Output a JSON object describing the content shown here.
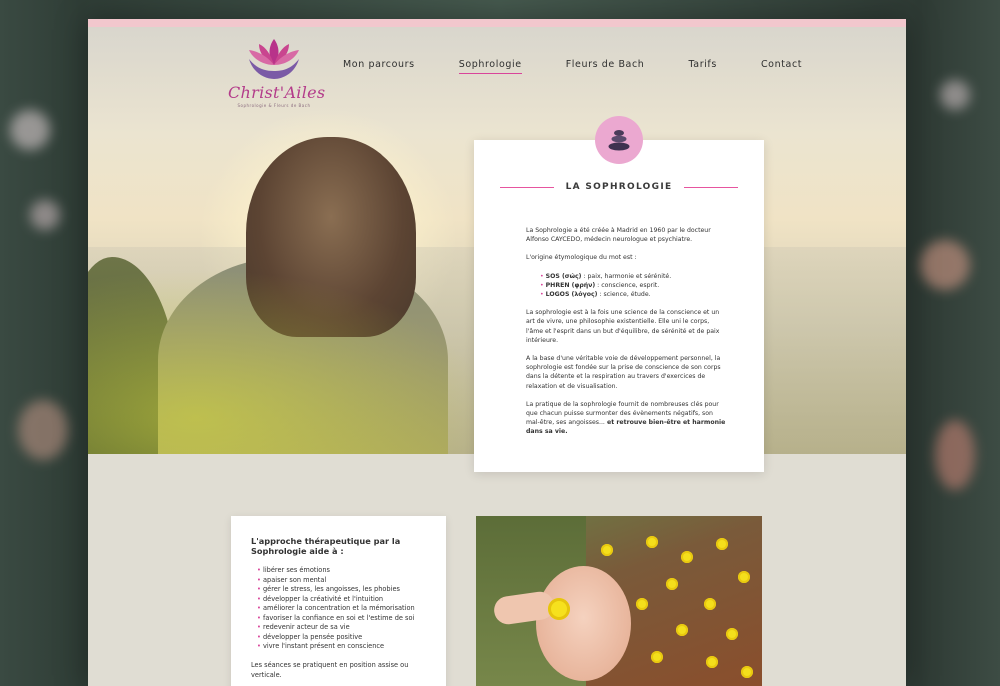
{
  "header": {
    "brand": "Christ'Ailes",
    "tagline": "Sophrologie & Fleurs de Bach",
    "nav": [
      {
        "label": "Mon parcours"
      },
      {
        "label": "Sophrologie",
        "active": true
      },
      {
        "label": "Fleurs de Bach"
      },
      {
        "label": "Tarifs"
      },
      {
        "label": "Contact"
      }
    ]
  },
  "sophrologie": {
    "title": "LA SOPHROLOGIE",
    "icon": "stacked-stones-icon",
    "p1": "La Sophrologie a été créée à Madrid en 1960 par le docteur Alfonso CAYCEDO, médecin neurologue et psychiatre.",
    "p2": "L'origine étymologique du mot est :",
    "etymology": [
      {
        "term": "SOS (σώς)",
        "def": " : paix, harmonie et sérénité."
      },
      {
        "term": "PHREN (φρήν)",
        "def": " : conscience, esprit."
      },
      {
        "term": "LOGOS (λόγος)",
        "def": " : science, étude."
      }
    ],
    "p3": "La sophrologie est à la fois une science de la conscience et un art de vivre, une philosophie existentielle. Elle uni le corps, l'âme et l'esprit dans un but d'équilibre, de sérénité et de paix intérieure.",
    "p4": "A la base d'une véritable voie de développement personnel, la sophrologie est fondée sur la prise de conscience de son corps dans la détente et la respiration au travers d'exercices de relaxation et de visualisation.",
    "p5": "La pratique de la sophrologie fournit de nombreuses clés pour que chacun puisse surmonter des évènements négatifs, son mal-être, ses angoisses...",
    "p5_bold": " et retrouve bien-être et harmonie dans sa vie."
  },
  "approach": {
    "title": "L'approche thérapeutique par la Sophrologie aide à :",
    "items": [
      "libérer ses émotions",
      "apaiser son mental",
      "gérer le stress, les angoisses, les phobies",
      "développer la créativité et l'intuition",
      "améliorer la concentration et la mémorisation",
      "favoriser la confiance en soi et l'estime de soi",
      "redevenir acteur de sa vie",
      "développer la pensée positive",
      "vivre l'instant présent en conscience"
    ],
    "footer": "Les séances se pratiquent en position assise ou verticale."
  },
  "colors": {
    "accent": "#e6559f",
    "badge": "#eba8d0",
    "background": "#e0ddd3"
  }
}
